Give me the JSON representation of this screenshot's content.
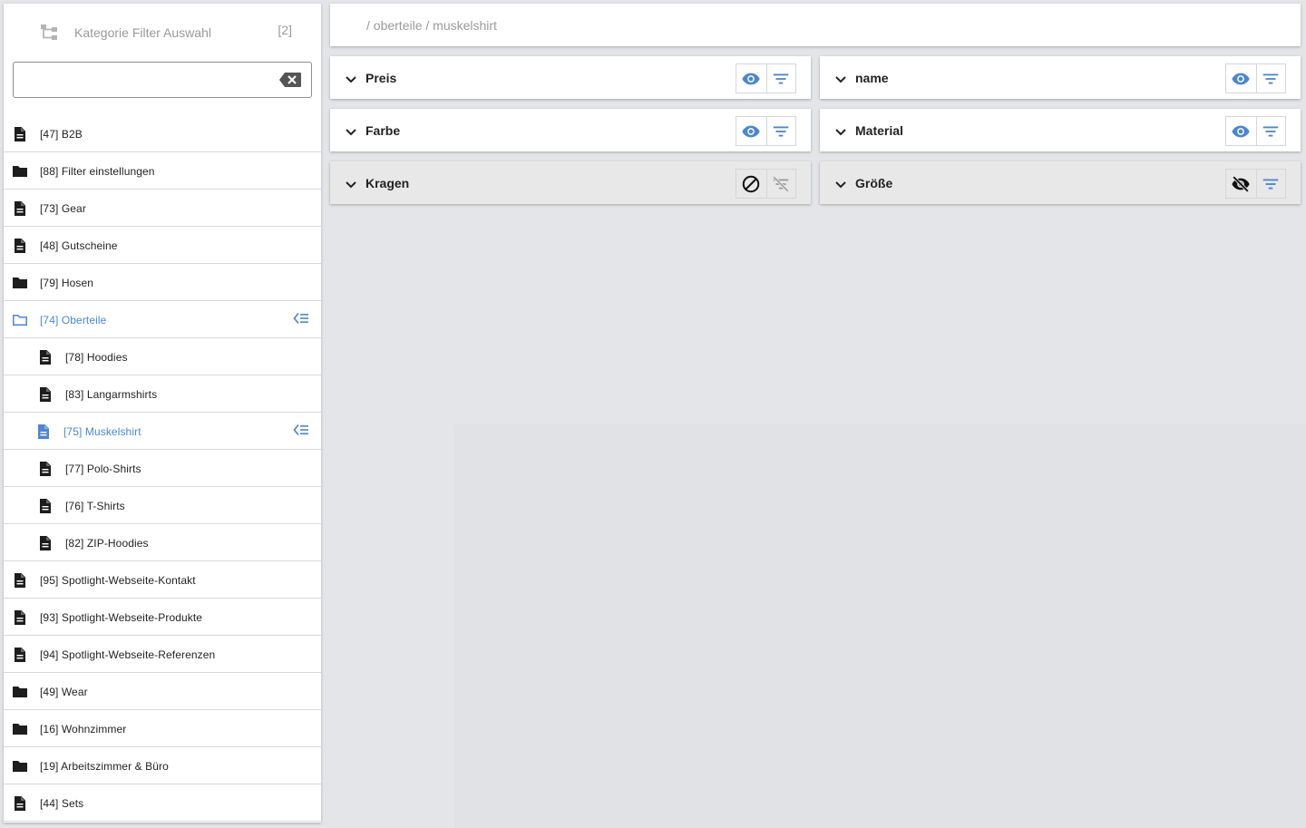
{
  "sidebar": {
    "title": "Kategorie Filter Auswahl",
    "count": "[2]",
    "search": {
      "value": "",
      "placeholder": ""
    },
    "items": [
      {
        "label": "[47] B2B",
        "icon": "document-icon",
        "level": 0,
        "selected": false
      },
      {
        "label": "[88] Filter einstellungen",
        "icon": "folder-icon",
        "level": 0,
        "selected": false
      },
      {
        "label": "[73] Gear",
        "icon": "document-icon",
        "level": 0,
        "selected": false
      },
      {
        "label": "[48] Gutscheine",
        "icon": "document-icon",
        "level": 0,
        "selected": false
      },
      {
        "label": "[79] Hosen",
        "icon": "folder-icon",
        "level": 0,
        "selected": false
      },
      {
        "label": "[74] Oberteile",
        "icon": "folder-open-icon",
        "level": 0,
        "selected": true
      },
      {
        "label": "[78] Hoodies",
        "icon": "document-icon",
        "level": 1,
        "selected": false
      },
      {
        "label": "[83] Langarmshirts",
        "icon": "document-icon",
        "level": 1,
        "selected": false
      },
      {
        "label": "[75] Muskelshirt",
        "icon": "document-icon",
        "level": 1,
        "selected": true
      },
      {
        "label": "[77] Polo-Shirts",
        "icon": "document-icon",
        "level": 1,
        "selected": false
      },
      {
        "label": "[76] T-Shirts",
        "icon": "document-icon",
        "level": 1,
        "selected": false
      },
      {
        "label": "[82] ZIP-Hoodies",
        "icon": "document-icon",
        "level": 1,
        "selected": false
      },
      {
        "label": "[95] Spotlight-Webseite-Kontakt",
        "icon": "document-icon",
        "level": 0,
        "selected": false
      },
      {
        "label": "[93] Spotlight-Webseite-Produkte",
        "icon": "document-icon",
        "level": 0,
        "selected": false
      },
      {
        "label": "[94] Spotlight-Webseite-Referenzen",
        "icon": "document-icon",
        "level": 0,
        "selected": false
      },
      {
        "label": "[49] Wear",
        "icon": "folder-icon",
        "level": 0,
        "selected": false
      },
      {
        "label": "[16] Wohnzimmer",
        "icon": "folder-icon",
        "level": 0,
        "selected": false
      },
      {
        "label": "[19] Arbeitszimmer & Büro",
        "icon": "folder-icon",
        "level": 0,
        "selected": false
      },
      {
        "label": "[44] Sets",
        "icon": "document-icon",
        "level": 0,
        "selected": false
      }
    ]
  },
  "breadcrumb": {
    "text": "/ oberteile / muskelshirt"
  },
  "filters": [
    {
      "name": "Preis",
      "state": "visible"
    },
    {
      "name": "name",
      "state": "visible"
    },
    {
      "name": "Farbe",
      "state": "visible"
    },
    {
      "name": "Material",
      "state": "visible"
    },
    {
      "name": "Kragen",
      "state": "disabled"
    },
    {
      "name": "Größe",
      "state": "hidden"
    }
  ],
  "colors": {
    "accent": "#4a86d3",
    "text": "#222222",
    "muted": "#9a9a9a",
    "background": "#e4e5e8",
    "disabled_card": "#e8e8e8"
  }
}
